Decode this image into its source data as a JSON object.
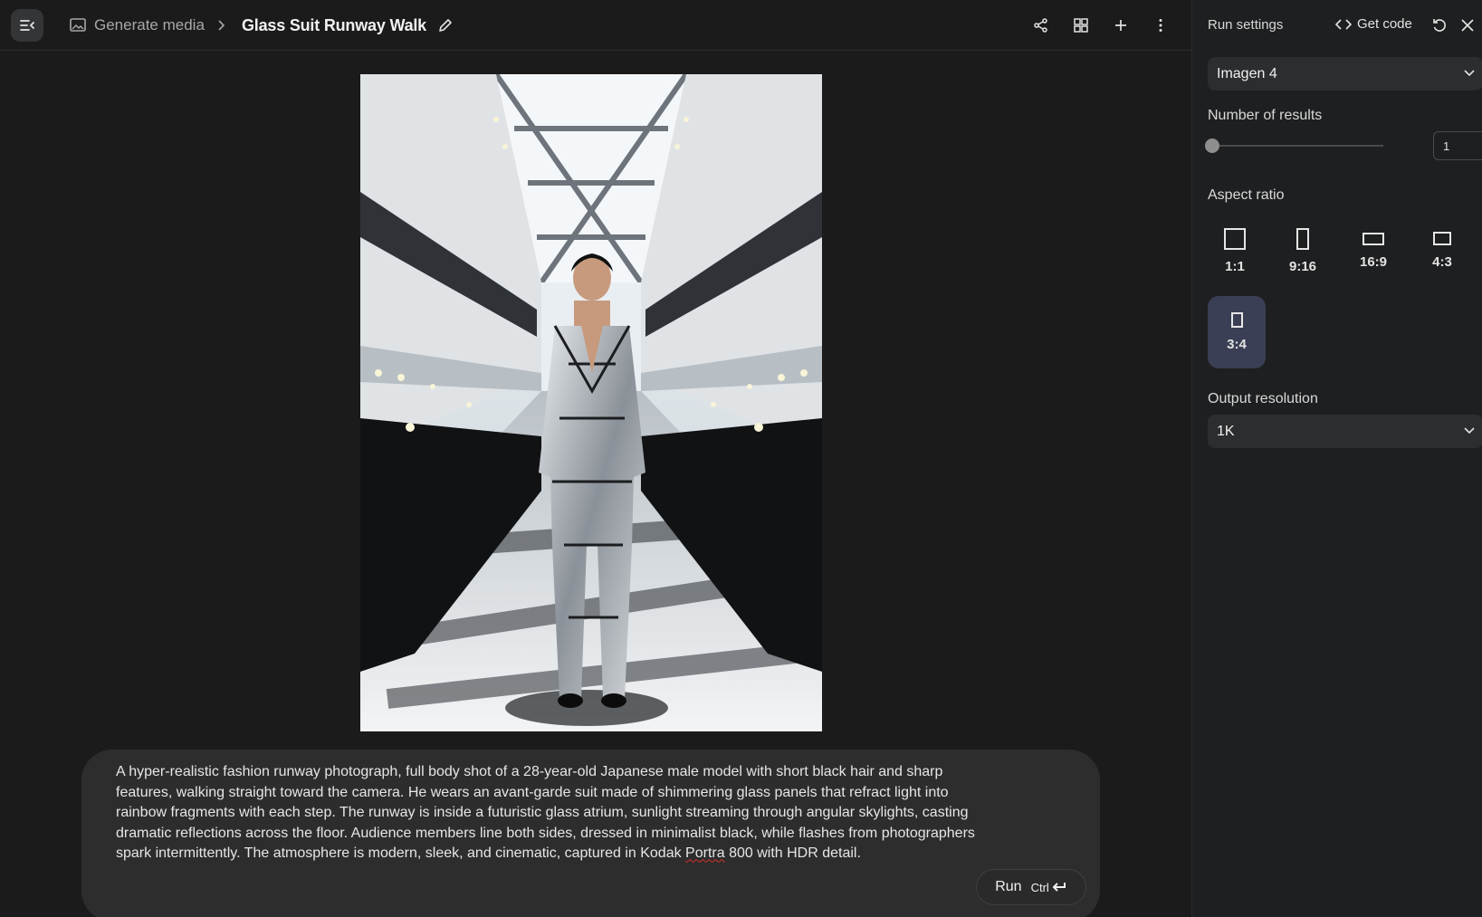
{
  "breadcrumb": {
    "section": "Generate media",
    "separator": ">",
    "title": "Glass Suit Runway Walk"
  },
  "image": {
    "description_icon": "generated-image"
  },
  "prompt": {
    "text_before": "A hyper-realistic fashion runway photograph, full body shot of a 28-year-old Japanese male model with short black hair and sharp features, walking straight toward the camera. He wears an avant-garde suit made of shimmering glass panels that refract light into rainbow fragments with each step. The runway is inside a futuristic glass atrium, sunlight streaming through angular skylights, casting dramatic reflections across the floor. Audience members line both sides, dressed in minimalist black, while flashes from photographers spark intermittently. The atmosphere is modern, sleek, and cinematic, captured in Kodak ",
    "spell_word": "Portra",
    "text_after": " 800 with HDR detail.",
    "run_label": "Run",
    "shortcut": "Ctrl"
  },
  "panel": {
    "title": "Run settings",
    "get_code": "Get code",
    "model": "Imagen 4",
    "results_label": "Number of results",
    "results_value": "1",
    "results_fraction": 0.0,
    "aspect_label": "Aspect ratio",
    "aspect_options": [
      {
        "label": "1:1",
        "selected": false
      },
      {
        "label": "9:16",
        "selected": false
      },
      {
        "label": "16:9",
        "selected": false
      },
      {
        "label": "4:3",
        "selected": false
      },
      {
        "label": "3:4",
        "selected": true
      }
    ],
    "resolution_label": "Output resolution",
    "resolution": "1K"
  },
  "colors": {
    "background": "#1b1b1b",
    "panel": "#1e1f20",
    "selected": "#3a3f55",
    "prompt_box": "#2d2d2d"
  }
}
